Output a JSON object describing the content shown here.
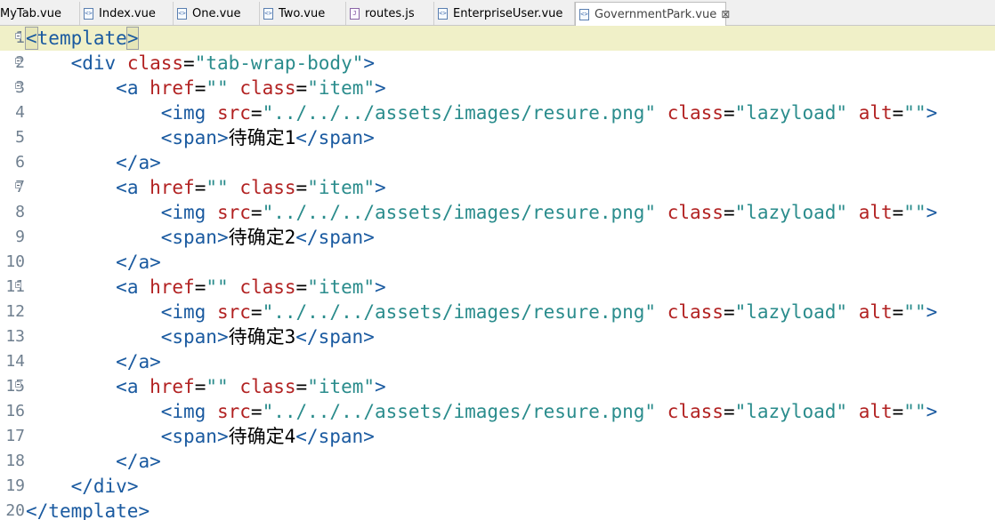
{
  "tabs": [
    {
      "label": "MyTab.vue",
      "icon": "vue-file-icon"
    },
    {
      "label": "Index.vue",
      "icon": "vue-file-icon"
    },
    {
      "label": "One.vue",
      "icon": "vue-file-icon"
    },
    {
      "label": "Two.vue",
      "icon": "vue-file-icon"
    },
    {
      "label": "routes.js",
      "icon": "js-file-icon"
    },
    {
      "label": "EnterpriseUser.vue",
      "icon": "vue-file-icon"
    },
    {
      "label": "GovernmentPark.vue",
      "icon": "vue-file-icon",
      "active": true
    }
  ],
  "close_glyph": "⊠",
  "gutter": [
    "1",
    "2",
    "3",
    "4",
    "5",
    "6",
    "7",
    "8",
    "9",
    "10",
    "11",
    "12",
    "13",
    "14",
    "15",
    "16",
    "17",
    "18",
    "19",
    "20"
  ],
  "code": {
    "template_tag": "template",
    "div_tag": "div",
    "a_tag": "a",
    "img_tag": "img",
    "span_tag": "span",
    "class_attr": "class",
    "href_attr": "href",
    "src_attr": "src",
    "alt_attr": "alt",
    "div_class": "\"tab-wrap-body\"",
    "item_class": "\"item\"",
    "empty_value": "\"\"",
    "img_src": "\"../../../assets/images/resure.png\"",
    "img_class": "\"lazyload\"",
    "span_texts": [
      "待确定1",
      "待确定2",
      "待确定3",
      "待确定4"
    ]
  }
}
